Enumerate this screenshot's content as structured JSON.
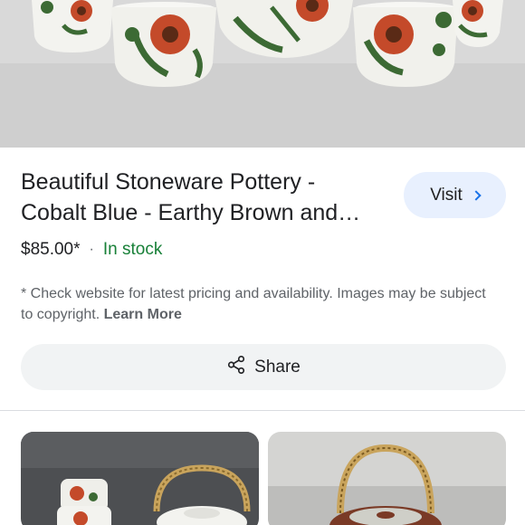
{
  "product": {
    "title": "Beautiful Stoneware Pottery - Cobalt Blue - Earthy Brown and…",
    "price": "$85.00*",
    "separator": "·",
    "stock_status": "In stock",
    "visit_label": "Visit"
  },
  "disclaimer": {
    "text": "* Check website for latest pricing and availability. Images may be subject to copyright.",
    "learn_more": "Learn More"
  },
  "share": {
    "label": "Share"
  },
  "icons": {
    "visit": "chevron-right-icon",
    "share": "share-icon"
  },
  "colors": {
    "accent": "#1a73e8",
    "in_stock": "#188038",
    "visit_button_bg": "#e8f0fe",
    "share_button_bg": "#f1f3f4"
  }
}
